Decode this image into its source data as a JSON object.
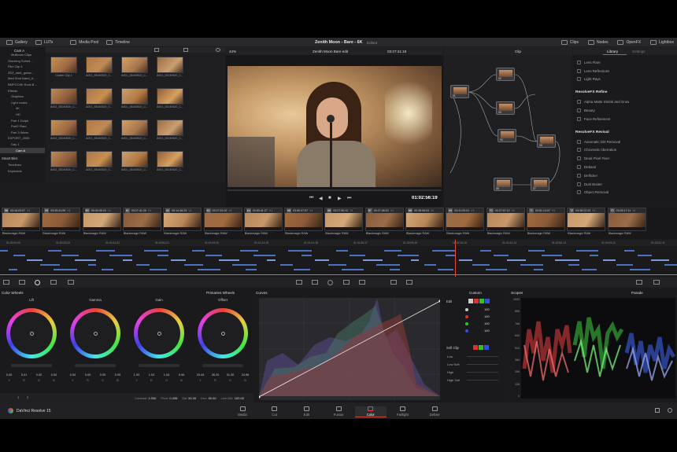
{
  "top_bar": {
    "items": [
      {
        "name": "gallery",
        "label": "Gallery"
      },
      {
        "name": "luts",
        "label": "LUTs"
      },
      {
        "name": "media-pool",
        "label": "Media Pool"
      },
      {
        "name": "timeline",
        "label": "Timeline"
      }
    ],
    "project_title": "Zenith Moon - Bare - 6K",
    "edited": "Edited",
    "right_items": [
      {
        "name": "clips",
        "label": "Clips"
      },
      {
        "name": "nodes",
        "label": "Nodes"
      },
      {
        "name": "openfx",
        "label": "OpenFX"
      },
      {
        "name": "lightbox",
        "label": "Lightbox"
      }
    ]
  },
  "media_pool": {
    "bin_header": "Cam A",
    "tree": [
      "Multicam Clips",
      "Shooting Sched...",
      "Film Clip 1",
      "ZEZ_dark_guitar...",
      "Med Shot Band_A...",
      "BMPCC6K Rock B...",
      "Effects",
      "Graphics",
      "Light Leaks",
      "4K",
      "HD",
      "Part 1 Dolph",
      "Part2 Flam",
      "Part 3 Warm",
      "EXPORT_2006",
      "Day 1",
      "Cam A"
    ],
    "smart_bins_label": "Smart Bins",
    "smart_bins": [
      "Timelines",
      "Keywords"
    ],
    "thumb_labels": [
      "Cluster Clip 1",
      "A001_06240520_C...",
      "A001_06240520_C...",
      "A001_06240520_C...",
      "A001_06240520_C...",
      "A001_06240520_C...",
      "A001_06240520_C...",
      "A001_06240520_C...",
      "A001_06240520_C...",
      "A001_06240520_C...",
      "A001_06240520_C...",
      "A001_06240520_C...",
      "A001_06240520_C...",
      "A001_06240520_C...",
      "A001_06240520_C...",
      "A001_06240520_C..."
    ]
  },
  "viewer": {
    "zoom": "44%",
    "clip_name": "Zenith Moon Bare edit",
    "timecode_top": "03:27:41:19",
    "timecode_bottom": "01:02:56:19"
  },
  "nodes": {
    "label": "Clip",
    "node_numbers": [
      "01",
      "02",
      "03",
      "04",
      "05",
      "06",
      "07"
    ]
  },
  "library": {
    "tab_library": "Library",
    "tab_settings": "Settings",
    "sections": [
      {
        "title": "",
        "items": [
          "Lens Flare",
          "Lens Reflections",
          "Light Rays"
        ]
      },
      {
        "title": "ResolveFX Refine",
        "items": [
          "Alpha Matte Shrink and Grow",
          "Beauty",
          "Face Refinement"
        ]
      },
      {
        "title": "ResolveFX Revival",
        "items": [
          "Automatic Dirt Removal",
          "Chromatic Aberration",
          "Dead Pixel Fixer",
          "Deband",
          "Deflicker",
          "Dust Buster",
          "Object Removal"
        ]
      }
    ]
  },
  "clips": [
    {
      "n": "58",
      "tc": "03:16:03:07",
      "v": "V1"
    },
    {
      "n": "59",
      "tc": "03:26:41:09",
      "v": "V1"
    },
    {
      "n": "60",
      "tc": "03:34:05:15",
      "v": "V1"
    },
    {
      "n": "61",
      "tc": "03:27:41:20",
      "v": "V1"
    },
    {
      "n": "62",
      "tc": "03:14:46:23",
      "v": "V1"
    },
    {
      "n": "63",
      "tc": "03:27:51:02",
      "v": "V1"
    },
    {
      "n": "64",
      "tc": "03:50:41:27",
      "v": "V1"
    },
    {
      "n": "65",
      "tc": "03:50:47:07",
      "v": "V1"
    },
    {
      "n": "66",
      "tc": "03:27:50:12",
      "v": "V1"
    },
    {
      "n": "67",
      "tc": "03:27:48:23",
      "v": "V1"
    },
    {
      "n": "68",
      "tc": "03:38:06:03",
      "v": "V1"
    },
    {
      "n": "69",
      "tc": "03:31:00:01",
      "v": "V1"
    },
    {
      "n": "70",
      "tc": "03:27:57:12",
      "v": "V1"
    },
    {
      "n": "71",
      "tc": "03:51:13:07",
      "v": "V1"
    },
    {
      "n": "72",
      "tc": "03:38:22:23",
      "v": "V1"
    },
    {
      "n": "73",
      "tc": "03:28:17:11",
      "v": "V1"
    }
  ],
  "clip_footer": "Blackmagic RAW",
  "ruler_ticks": [
    "01:00:00:00",
    "01:00:25:23",
    "01:00:41:22",
    "01:00:54:21",
    "01:01:09:20",
    "01:01:24:19",
    "01:01:41:18",
    "01:01:56:17",
    "01:02:09:16",
    "01:02:26:15",
    "01:02:41:14",
    "01:02:56:13",
    "01:03:09:12",
    "01:03:21:11"
  ],
  "color_wheels": {
    "title": "Color Wheels",
    "mode": "Primaries Wheels",
    "wheels": [
      {
        "name": "Lift",
        "values": [
          "0.00",
          "0.01",
          "0.00",
          "0.00"
        ]
      },
      {
        "name": "Gamma",
        "values": [
          "0.00",
          "0.00",
          "0.00",
          "0.00"
        ]
      },
      {
        "name": "Gain",
        "values": [
          "1.00",
          "1.03",
          "1.04",
          "0.94"
        ]
      },
      {
        "name": "Offset",
        "values": [
          "20.44",
          "26.20",
          "31.30",
          "24.96"
        ]
      }
    ],
    "value_letters": [
      "Y",
      "R",
      "G",
      "B"
    ],
    "footer": [
      {
        "label": "Contrast",
        "value": "1.000"
      },
      {
        "label": "Pivot",
        "value": "0.435"
      },
      {
        "label": "Sat",
        "value": "50.00"
      },
      {
        "label": "Hue",
        "value": "50.00"
      },
      {
        "label": "Lum Mix",
        "value": "100.00"
      }
    ],
    "page_numbers": [
      "1",
      "2"
    ]
  },
  "curves": {
    "title": "Curves",
    "mode": "Custom",
    "edit_label": "Edit",
    "edit_values": [
      "100",
      "100",
      "100",
      "100"
    ],
    "soft_clip_label": "Soft Clip",
    "soft_clip_items": [
      "Low",
      "Low Soft",
      "High",
      "High Soft"
    ]
  },
  "scopes": {
    "title": "Scopes",
    "mode": "Parade",
    "scale": [
      "1023",
      "896",
      "768",
      "640",
      "512",
      "384",
      "256",
      "128",
      "0"
    ]
  },
  "bottom_nav": {
    "app_name": "DaVinci Resolve 15",
    "pages": [
      "Media",
      "Cut",
      "Edit",
      "Fusion",
      "Color",
      "Fairlight",
      "Deliver"
    ],
    "active": "Color"
  },
  "colors": {
    "accent": "#e8453c",
    "active_tab": "#d04a3a",
    "bg": "#1c1c1f"
  }
}
